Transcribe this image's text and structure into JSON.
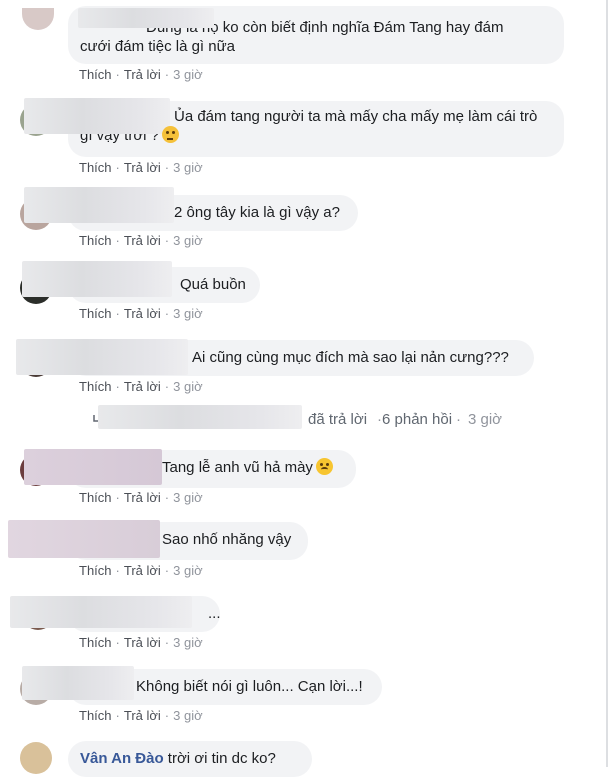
{
  "actions": {
    "like": "Thích",
    "reply": "Trả lời",
    "separator": "·"
  },
  "comments": [
    {
      "text": "Đúng là họ ko còn biết định nghĩa Đám Tang hay đám",
      "text2": "cưới đám tiệc là gì nữa",
      "time": "3 giờ"
    },
    {
      "text": "Ủa đám tang người ta mà mấy cha mấy mẹ làm cái trò",
      "text2": "gì vậy trời ?",
      "emoji": "rolling-eyes-emoji",
      "time": "3 giờ"
    },
    {
      "text": "2 ông tây kia là gì vậy a?",
      "time": "3 giờ"
    },
    {
      "text": "Quá buồn",
      "time": "3 giờ"
    },
    {
      "text": "Ai cũng cùng mục đích mà sao lại nản cưng???",
      "time": "3 giờ"
    },
    {
      "text": "Tang lễ anh vũ hả mày",
      "emoji": "sad-emoji",
      "time": "3 giờ"
    },
    {
      "text": "Sao nhố nhăng vậy",
      "time": "3 giờ"
    },
    {
      "text": "...",
      "time": "3 giờ"
    },
    {
      "text": "Không biết nói gì luôn... Cạn lời...!",
      "time": "3 giờ"
    },
    {
      "name": "Vân An Đào",
      "text": "trời ơi tin dc ko?"
    }
  ],
  "reply_summary": {
    "label": "đã trả lời",
    "separator": "·",
    "count": "6 phản hồi",
    "time": "3 giờ"
  }
}
